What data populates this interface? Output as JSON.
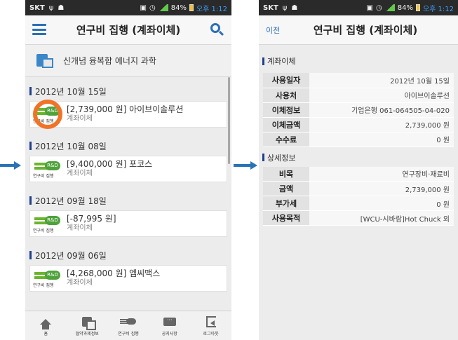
{
  "status_left": {
    "carrier": "SKT",
    "battery": "84%",
    "time": "오후 1:12"
  },
  "status_right": {
    "carrier": "SKT",
    "battery": "84%",
    "time": "오후 1:12"
  },
  "left_screen": {
    "title": "연구비 집행 (계좌이체)",
    "org_name": "신개념 융복합 에너지 과학",
    "icon_badge": "R&D",
    "icon_caption": "연구비 집행",
    "groups": [
      {
        "date": "2012년 10월 15일",
        "amount_text": "[2,739,000 원] 아이브이솔루션",
        "type": "계좌이체"
      },
      {
        "date": "2012년 10월 08일",
        "amount_text": "[9,400,000 원] 포코스",
        "type": "계좌이체"
      },
      {
        "date": "2012년 09월 18일",
        "amount_text": "[-87,995 원]",
        "type": "계좌이체"
      },
      {
        "date": "2012년 09월 06일",
        "amount_text": "[4,268,000 원] 엠씨맥스",
        "type": "계좌이체"
      }
    ],
    "nav": [
      {
        "label": "홈",
        "icon": "home-icon"
      },
      {
        "label": "협약과제정보",
        "icon": "document-icon"
      },
      {
        "label": "연구비 집행",
        "icon": "rnd-icon"
      },
      {
        "label": "공지사항",
        "icon": "notice-icon"
      },
      {
        "label": "로그아웃",
        "icon": "logout-icon"
      }
    ]
  },
  "right_screen": {
    "back_label": "이전",
    "title": "연구비 집행 (계좌이체)",
    "transfer_section": "계좌이체",
    "transfer_rows": [
      {
        "key": "사용일자",
        "value": "2012년 10월 15일"
      },
      {
        "key": "사용처",
        "value": "아이브이솔루션"
      },
      {
        "key": "이체정보",
        "value": "기업은행 061-064505-04-020"
      },
      {
        "key": "이체금액",
        "value": "2,739,000 원"
      },
      {
        "key": "수수료",
        "value": "0 원"
      }
    ],
    "detail_section": "상세정보",
    "detail_rows": [
      {
        "key": "비목",
        "value": "연구장비·재료비"
      },
      {
        "key": "금액",
        "value": "2,739,000 원"
      },
      {
        "key": "부가세",
        "value": "0 원"
      },
      {
        "key": "사용목적",
        "value": "[WCU-시바람]Hot Chuck 외"
      }
    ]
  },
  "colors": {
    "accent": "#2b6fb6",
    "highlight": "#f07327",
    "arrow": "#2872b8",
    "rnd_green": "#4ea23b"
  }
}
